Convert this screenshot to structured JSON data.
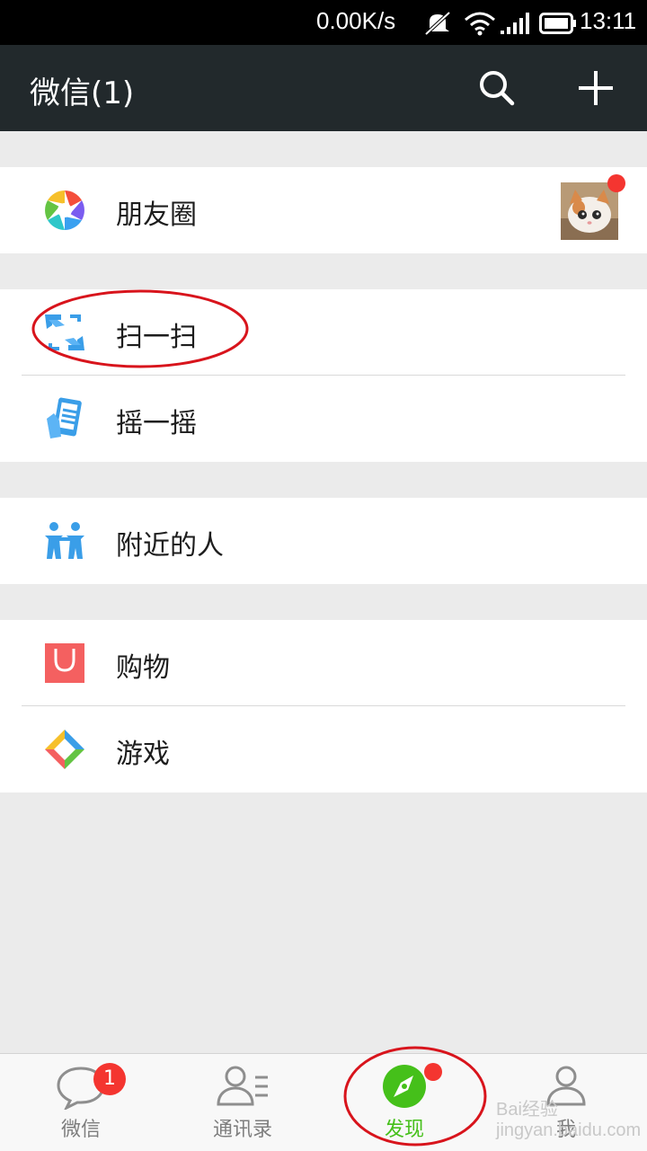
{
  "status_bar": {
    "speed": "0.00K/s",
    "time": "13:11"
  },
  "header": {
    "title": "微信(1)"
  },
  "groups": {
    "moments": {
      "label": "朋友圈"
    },
    "scan": {
      "label": "扫一扫"
    },
    "shake": {
      "label": "摇一摇"
    },
    "nearby": {
      "label": "附近的人"
    },
    "shopping": {
      "label": "购物"
    },
    "games": {
      "label": "游戏"
    }
  },
  "tabs": [
    {
      "label": "微信",
      "badge": "1"
    },
    {
      "label": "通讯录"
    },
    {
      "label": "发现"
    },
    {
      "label": "我"
    }
  ],
  "colors": {
    "accent": "#45c01a",
    "topbar": "#22292c",
    "badge": "#f43530"
  },
  "watermark": "Bai经验 jingyan.baidu.com"
}
